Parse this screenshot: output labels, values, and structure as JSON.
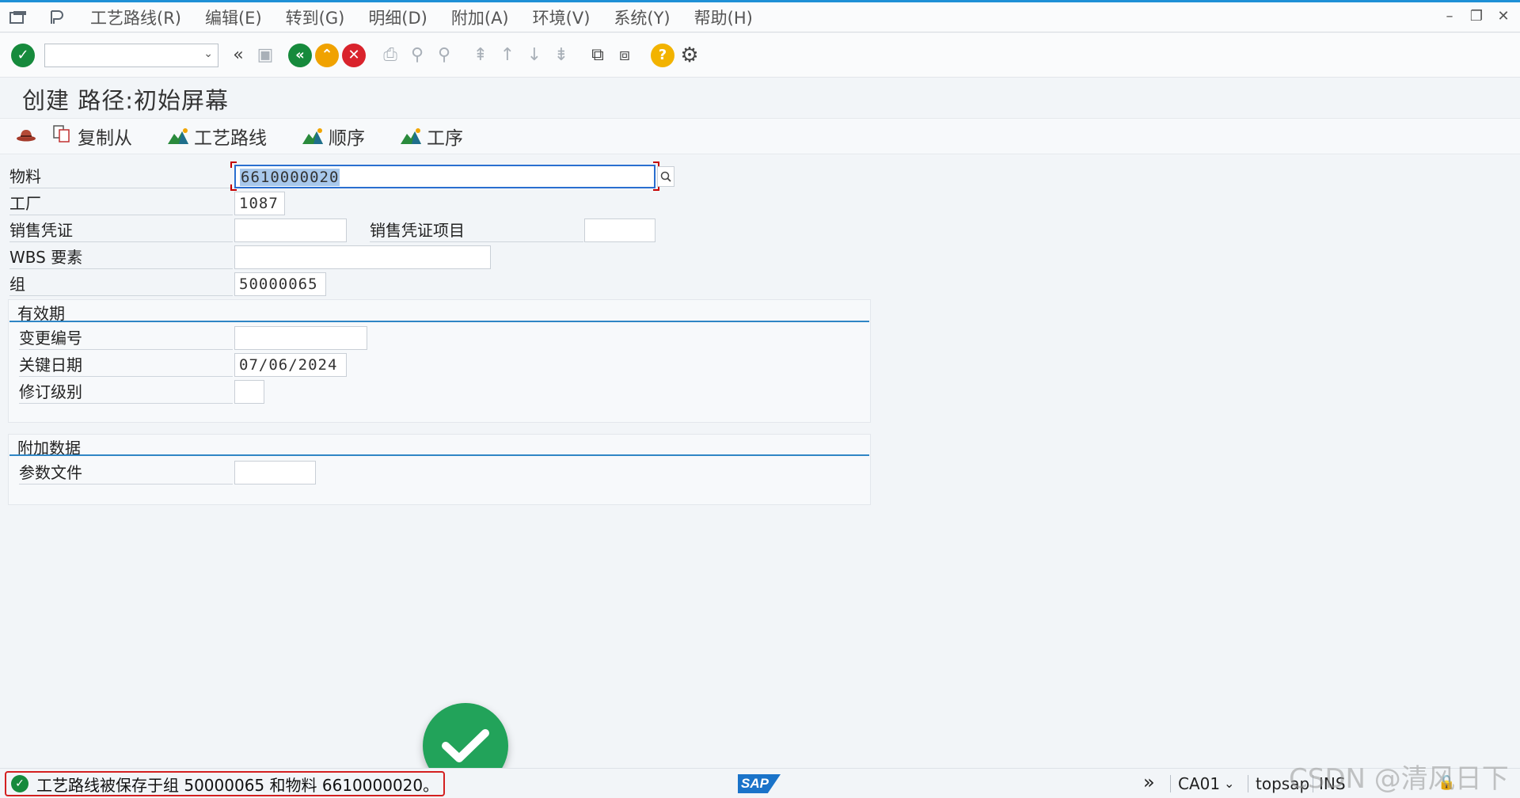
{
  "menu": {
    "items": [
      "工艺路线(R)",
      "编辑(E)",
      "转到(G)",
      "明细(D)",
      "附加(A)",
      "环境(V)",
      "系统(Y)",
      "帮助(H)"
    ]
  },
  "toolbar": {
    "command_value": ""
  },
  "title": "创建 路径:初始屏幕",
  "app_toolbar": {
    "copy_from": "复制从",
    "routing": "工艺路线",
    "sequence": "顺序",
    "operation": "工序"
  },
  "form": {
    "material_label": "物料",
    "material_value": "6610000020",
    "plant_label": "工厂",
    "plant_value": "1087",
    "sales_doc_label": "销售凭证",
    "sales_doc_value": "",
    "sales_doc_item_label": "销售凭证项目",
    "sales_doc_item_value": "",
    "wbs_label": "WBS 要素",
    "wbs_value": "",
    "group_label": "组",
    "group_value": "50000065"
  },
  "validity": {
    "title": "有效期",
    "change_no_label": "变更编号",
    "change_no_value": "",
    "key_date_label": "关键日期",
    "key_date_value": "07/06/2024",
    "revision_label": "修订级别",
    "revision_value": ""
  },
  "additional": {
    "title": "附加数据",
    "profile_label": "参数文件",
    "profile_value": ""
  },
  "status": {
    "message": "工艺路线被保存于组 50000065 和物料 6610000020。",
    "transaction": "CA01",
    "system": "topsap",
    "mode": "INS",
    "sap_logo": "SAP"
  },
  "watermark": "CSDN @清风日下",
  "colors": {
    "accent": "#2f86c5",
    "success": "#168a3c",
    "error_frame": "#d42020"
  }
}
